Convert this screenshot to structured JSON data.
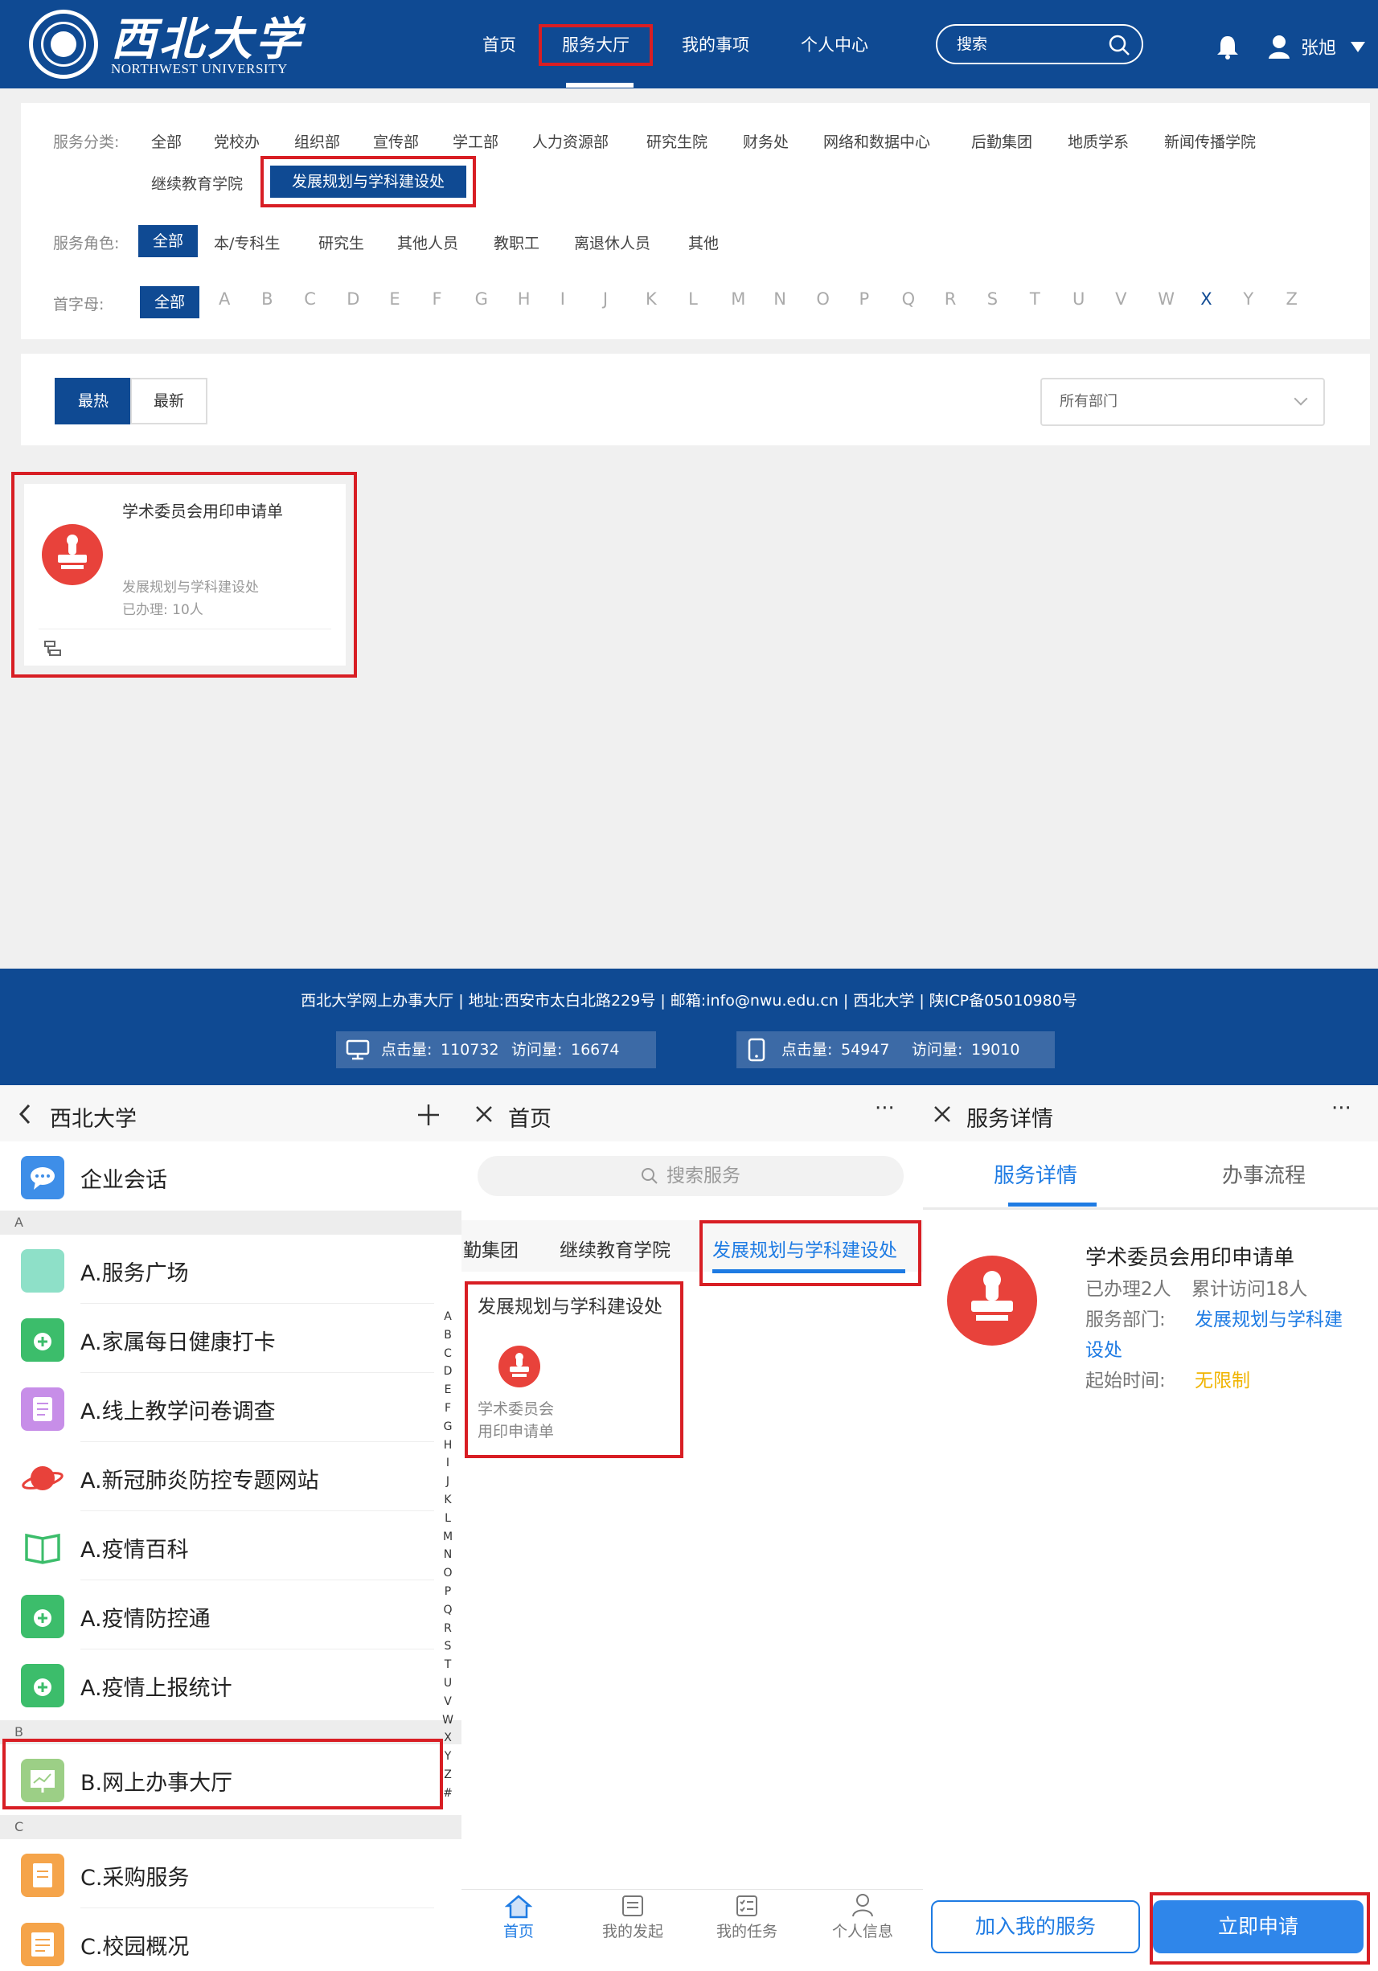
{
  "desktop": {
    "logo": {
      "cn": "西北大学",
      "en": "NORTHWEST UNIVERSITY"
    },
    "nav": [
      "首页",
      "服务大厅",
      "我的事项",
      "个人中心"
    ],
    "search": "搜索",
    "user": "张旭",
    "filters": {
      "category_label": "服务分类:",
      "categories": [
        "全部",
        "党校办",
        "组织部",
        "宣传部",
        "学工部",
        "人力资源部",
        "研究生院",
        "财务处",
        "网络和数据中心",
        "后勤集团",
        "地质学系",
        "新闻传播学院",
        "继续教育学院",
        "发展规划与学科建设处"
      ],
      "role_label": "服务角色:",
      "roles": [
        "全部",
        "本/专科生",
        "研究生",
        "其他人员",
        "教职工",
        "离退休人员",
        "其他"
      ],
      "initial_label": "首字母:",
      "initial_all": "全部",
      "letters": [
        "A",
        "B",
        "C",
        "D",
        "E",
        "F",
        "G",
        "H",
        "I",
        "J",
        "K",
        "L",
        "M",
        "N",
        "O",
        "P",
        "Q",
        "R",
        "S",
        "T",
        "U",
        "V",
        "W",
        "X",
        "Y",
        "Z"
      ]
    },
    "sort": [
      "最热",
      "最新"
    ],
    "dept_select": "所有部门",
    "card": {
      "title": "学术委员会用印申请单",
      "dept": "发展规划与学科建设处",
      "count": "已办理: 10人"
    },
    "footer": {
      "text": "西北大学网上办事大厅 | 地址:西安市太白北路229号 | 邮箱:info@nwu.edu.cn | 西北大学 | 陕ICP备05010980号",
      "pc": {
        "clicks_label": "点击量:",
        "clicks": "110732",
        "visits_label": "访问量:",
        "visits": "16674"
      },
      "mobile": {
        "clicks_label": "点击量:",
        "clicks": "54947",
        "visits_label": "访问量:",
        "visits": "19010"
      }
    }
  },
  "mobile_contacts": {
    "title": "西北大学",
    "top_item": "企业会话",
    "group_a": "A",
    "items_a": [
      "A.服务广场",
      "A.家属每日健康打卡",
      "A.线上教学问卷调查",
      "A.新冠肺炎防控专题网站",
      "A.疫情百科",
      "A.疫情防控通",
      "A.疫情上报统计"
    ],
    "group_b": "B",
    "item_b": "B.网上办事大厅",
    "group_c": "C",
    "items_c": [
      "C.采购服务",
      "C.校园概况"
    ],
    "index": [
      "A",
      "B",
      "C",
      "D",
      "E",
      "F",
      "G",
      "H",
      "I",
      "J",
      "K",
      "L",
      "M",
      "N",
      "O",
      "P",
      "Q",
      "R",
      "S",
      "T",
      "U",
      "V",
      "W",
      "X",
      "Y",
      "Z",
      "#"
    ]
  },
  "mobile_home": {
    "title": "首页",
    "search_placeholder": "搜索服务",
    "tabs": [
      "勤集团",
      "继续教育学院",
      "发展规划与学科建设处"
    ],
    "section_title": "发展规划与学科建设处",
    "service_line1": "学术委员会",
    "service_line2": "用印申请单",
    "tabbar": [
      "首页",
      "我的发起",
      "我的任务",
      "个人信息"
    ]
  },
  "mobile_detail": {
    "title": "服务详情",
    "tabs": [
      "服务详情",
      "办事流程"
    ],
    "name": "学术委员会用印申请单",
    "handled": "已办理2人",
    "visits": "累计访问18人",
    "dept_label": "服务部门:",
    "dept_line1": "发展规划与学科建",
    "dept_line2": "设处",
    "time_label": "起始时间:",
    "time_value": "无限制",
    "btn_add": "加入我的服务",
    "btn_apply": "立即申请"
  },
  "colors": {
    "primary": "#0f4a93",
    "highlight": "#d81e24",
    "stamp": "#e8423b",
    "link": "#1e7be3",
    "warning": "#f0b400"
  }
}
